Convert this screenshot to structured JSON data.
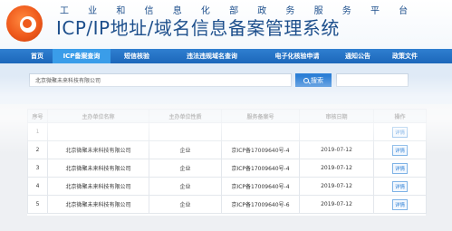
{
  "header": {
    "subtitle": "工 业 和 信 息 化 部 政 务 服 务 平 台",
    "title": "ICP/IP地址/域名信息备案管理系统"
  },
  "nav": {
    "items": [
      {
        "label": "首页",
        "active": false
      },
      {
        "label": "ICP备案查询",
        "active": true
      },
      {
        "label": "短信核验",
        "active": false
      },
      {
        "label": "违法违规域名查询",
        "active": false
      },
      {
        "label": "电子化核验申请",
        "active": false
      },
      {
        "label": "通知公告",
        "active": false
      },
      {
        "label": "政策文件",
        "active": false
      }
    ]
  },
  "search": {
    "value": "北京微聚未来科技有限公司",
    "button_label": "搜索"
  },
  "table": {
    "headers": [
      "序号",
      "主办单位名称",
      "主办单位性质",
      "服务备案号",
      "审核日期",
      "操作"
    ],
    "rows": [
      {
        "index": "1",
        "name": "",
        "type": "",
        "license": "",
        "date": "",
        "action": "详情"
      },
      {
        "index": "2",
        "name": "北京微聚未来科技有限公司",
        "type": "企业",
        "license": "京ICP备17009640号-4",
        "date": "2019-07-12",
        "action": "详情"
      },
      {
        "index": "3",
        "name": "北京微聚未来科技有限公司",
        "type": "企业",
        "license": "京ICP备17009640号-4",
        "date": "2019-07-12",
        "action": "详情"
      },
      {
        "index": "4",
        "name": "北京微聚未来科技有限公司",
        "type": "企业",
        "license": "京ICP备17009640号-4",
        "date": "2019-07-12",
        "action": "详情"
      },
      {
        "index": "5",
        "name": "北京微聚未来科技有限公司",
        "type": "企业",
        "license": "京ICP备17009640号-6",
        "date": "2019-07-12",
        "action": "详情"
      }
    ]
  },
  "colors": {
    "brand_blue": "#1d4f8c",
    "nav_blue": "#2a74c8",
    "accent_orange": "#ef5a1c"
  }
}
